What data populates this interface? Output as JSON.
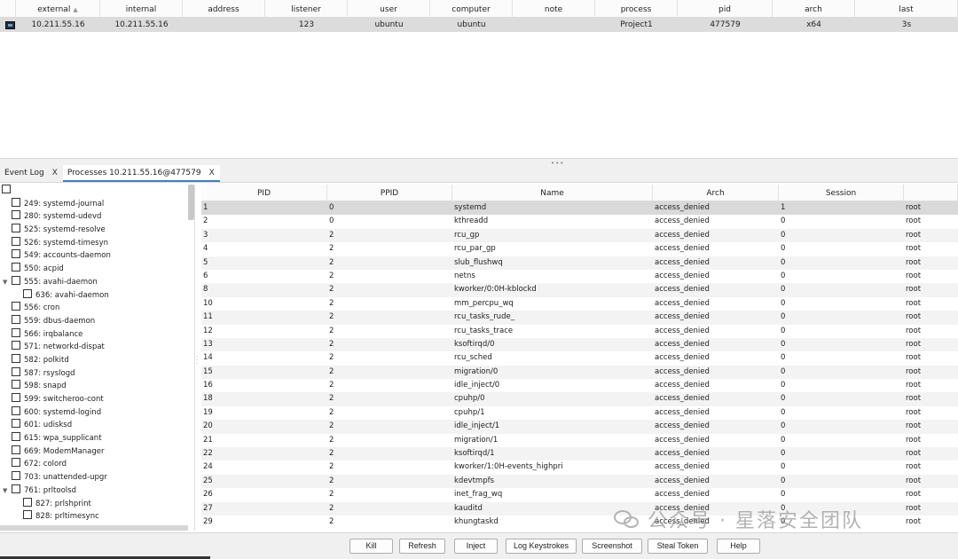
{
  "sessions": {
    "columns": [
      "external",
      "internal",
      "address",
      "listener",
      "user",
      "computer",
      "note",
      "process",
      "pid",
      "arch",
      "last"
    ],
    "sort_indicator": "▲",
    "rows": [
      {
        "external": "10.211.55.16",
        "internal": "10.211.55.16",
        "address": "",
        "listener": "123",
        "user": "ubuntu",
        "computer": "ubuntu",
        "note": "",
        "process": "Project1",
        "pid": "477579",
        "arch": "x64",
        "last": "3s"
      }
    ]
  },
  "tabs": [
    {
      "label": "Event Log",
      "close": "X"
    },
    {
      "label": "Processes 10.211.55.16@477579",
      "close": "X"
    }
  ],
  "tree": [
    {
      "label": "",
      "indent": 0,
      "arrow": ""
    },
    {
      "label": "249: systemd-journal",
      "indent": 1,
      "arrow": ""
    },
    {
      "label": "280: systemd-udevd",
      "indent": 1,
      "arrow": ""
    },
    {
      "label": "525: systemd-resolve",
      "indent": 1,
      "arrow": ""
    },
    {
      "label": "526: systemd-timesyn",
      "indent": 1,
      "arrow": ""
    },
    {
      "label": "549: accounts-daemon",
      "indent": 1,
      "arrow": ""
    },
    {
      "label": "550: acpid",
      "indent": 1,
      "arrow": ""
    },
    {
      "label": "555: avahi-daemon",
      "indent": 1,
      "arrow": "▼"
    },
    {
      "label": "636: avahi-daemon",
      "indent": 2,
      "arrow": ""
    },
    {
      "label": "556: cron",
      "indent": 1,
      "arrow": ""
    },
    {
      "label": "559: dbus-daemon",
      "indent": 1,
      "arrow": ""
    },
    {
      "label": "566: irqbalance",
      "indent": 1,
      "arrow": ""
    },
    {
      "label": "571: networkd-dispat",
      "indent": 1,
      "arrow": ""
    },
    {
      "label": "582: polkitd",
      "indent": 1,
      "arrow": ""
    },
    {
      "label": "587: rsyslogd",
      "indent": 1,
      "arrow": ""
    },
    {
      "label": "598: snapd",
      "indent": 1,
      "arrow": ""
    },
    {
      "label": "599: switcheroo-cont",
      "indent": 1,
      "arrow": ""
    },
    {
      "label": "600: systemd-logind",
      "indent": 1,
      "arrow": ""
    },
    {
      "label": "601: udisksd",
      "indent": 1,
      "arrow": ""
    },
    {
      "label": "615: wpa_supplicant",
      "indent": 1,
      "arrow": ""
    },
    {
      "label": "669: ModemManager",
      "indent": 1,
      "arrow": ""
    },
    {
      "label": "672: colord",
      "indent": 1,
      "arrow": ""
    },
    {
      "label": "703: unattended-upgr",
      "indent": 1,
      "arrow": ""
    },
    {
      "label": "761: prltoolsd",
      "indent": 1,
      "arrow": "▼"
    },
    {
      "label": "827: prlshprint",
      "indent": 2,
      "arrow": ""
    },
    {
      "label": "828: prltimesync",
      "indent": 2,
      "arrow": ""
    }
  ],
  "processes": {
    "columns": [
      "PID",
      "PPID",
      "Name",
      "Arch",
      "Session",
      ""
    ],
    "rows": [
      [
        "1",
        "0",
        "systemd",
        "access_denied",
        "1",
        "root"
      ],
      [
        "2",
        "0",
        "kthreadd",
        "access_denied",
        "0",
        "root"
      ],
      [
        "3",
        "2",
        "rcu_gp",
        "access_denied",
        "0",
        "root"
      ],
      [
        "4",
        "2",
        "rcu_par_gp",
        "access_denied",
        "0",
        "root"
      ],
      [
        "5",
        "2",
        "slub_flushwq",
        "access_denied",
        "0",
        "root"
      ],
      [
        "6",
        "2",
        "netns",
        "access_denied",
        "0",
        "root"
      ],
      [
        "8",
        "2",
        "kworker/0:0H-kblockd",
        "access_denied",
        "0",
        "root"
      ],
      [
        "10",
        "2",
        "mm_percpu_wq",
        "access_denied",
        "0",
        "root"
      ],
      [
        "11",
        "2",
        "rcu_tasks_rude_",
        "access_denied",
        "0",
        "root"
      ],
      [
        "12",
        "2",
        "rcu_tasks_trace",
        "access_denied",
        "0",
        "root"
      ],
      [
        "13",
        "2",
        "ksoftirqd/0",
        "access_denied",
        "0",
        "root"
      ],
      [
        "14",
        "2",
        "rcu_sched",
        "access_denied",
        "0",
        "root"
      ],
      [
        "15",
        "2",
        "migration/0",
        "access_denied",
        "0",
        "root"
      ],
      [
        "16",
        "2",
        "idle_inject/0",
        "access_denied",
        "0",
        "root"
      ],
      [
        "18",
        "2",
        "cpuhp/0",
        "access_denied",
        "0",
        "root"
      ],
      [
        "19",
        "2",
        "cpuhp/1",
        "access_denied",
        "0",
        "root"
      ],
      [
        "20",
        "2",
        "idle_inject/1",
        "access_denied",
        "0",
        "root"
      ],
      [
        "21",
        "2",
        "migration/1",
        "access_denied",
        "0",
        "root"
      ],
      [
        "22",
        "2",
        "ksoftirqd/1",
        "access_denied",
        "0",
        "root"
      ],
      [
        "24",
        "2",
        "kworker/1:0H-events_highpri",
        "access_denied",
        "0",
        "root"
      ],
      [
        "25",
        "2",
        "kdevtmpfs",
        "access_denied",
        "0",
        "root"
      ],
      [
        "26",
        "2",
        "inet_frag_wq",
        "access_denied",
        "0",
        "root"
      ],
      [
        "27",
        "2",
        "kauditd",
        "access_denied",
        "0",
        "root"
      ],
      [
        "29",
        "2",
        "khungtaskd",
        "access_denied",
        "0",
        "root"
      ]
    ]
  },
  "buttons": [
    "Kill",
    "Refresh",
    "Inject",
    "Log Keystrokes",
    "Screenshot",
    "Steal Token",
    "Help"
  ],
  "watermark": {
    "text": "公众号 · 星落安全团队"
  },
  "icons": {
    "session": "terminal-icon",
    "checkbox": "checkbox-icon",
    "expand": "expand-arrow-icon"
  }
}
